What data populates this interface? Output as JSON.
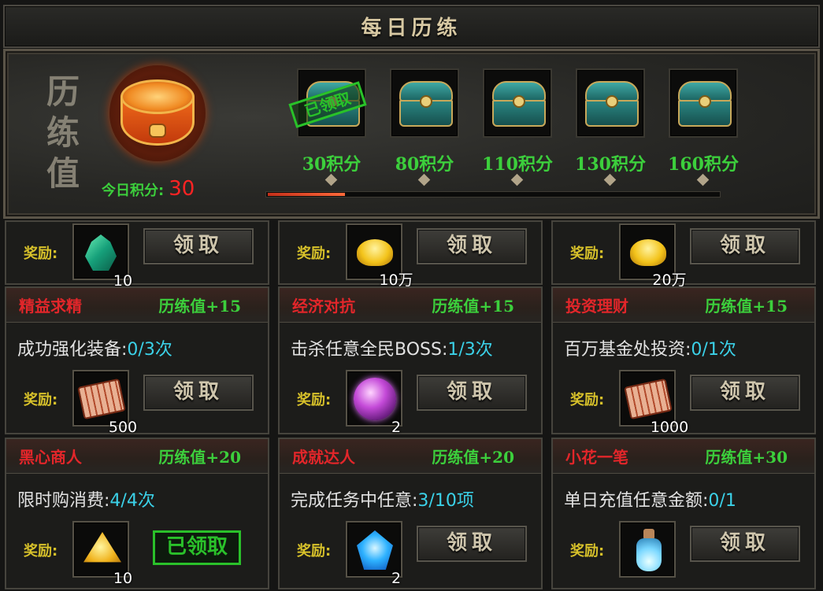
{
  "title": "每日历练",
  "calligraphy": "历练值",
  "today_score_label": "今日积分:",
  "today_score_value": "30",
  "progress_fraction": 0.17,
  "chests": [
    {
      "points": "30积分",
      "claimed": true,
      "claimed_text": "已领取"
    },
    {
      "points": "80积分",
      "claimed": false
    },
    {
      "points": "110积分",
      "claimed": false
    },
    {
      "points": "130积分",
      "claimed": false
    },
    {
      "points": "160积分",
      "claimed": false
    }
  ],
  "reward_label": "奖励:",
  "claim_label": "领取",
  "claimed_label": "已领取",
  "top_rewards": [
    {
      "icon": "crystal-icon",
      "qty": "10"
    },
    {
      "icon": "gold-ingot-icon",
      "qty": "10万"
    },
    {
      "icon": "gold-ingot-icon",
      "qty": "20万"
    }
  ],
  "tasks": [
    {
      "name": "精益求精",
      "reward": "历练值+15",
      "desc": "成功强化装备:",
      "progress": "0/3次",
      "icon": "scroll-icon",
      "qty": "500",
      "claimed": false
    },
    {
      "name": "经济对抗",
      "reward": "历练值+15",
      "desc": "击杀任意全民BOSS:",
      "progress": "1/3次",
      "icon": "purple-orb-icon",
      "qty": "2",
      "claimed": false
    },
    {
      "name": "投资理财",
      "reward": "历练值+15",
      "desc": "百万基金处投资:",
      "progress": "0/1次",
      "icon": "scroll-icon",
      "qty": "1000",
      "claimed": false
    },
    {
      "name": "黑心商人",
      "reward": "历练值+20",
      "desc": "限时购消费:",
      "progress": "4/4次",
      "icon": "gold-ore-icon",
      "qty": "10",
      "claimed": true
    },
    {
      "name": "成就达人",
      "reward": "历练值+20",
      "desc": "完成任务中任意:",
      "progress": "3/10项",
      "icon": "blue-gem-icon",
      "qty": "2",
      "claimed": false
    },
    {
      "name": "小花一笔",
      "reward": "历练值+30",
      "desc": "单日充值任意金额:",
      "progress": "0/1",
      "icon": "potion-bottle-icon",
      "qty": "",
      "claimed": false
    }
  ]
}
